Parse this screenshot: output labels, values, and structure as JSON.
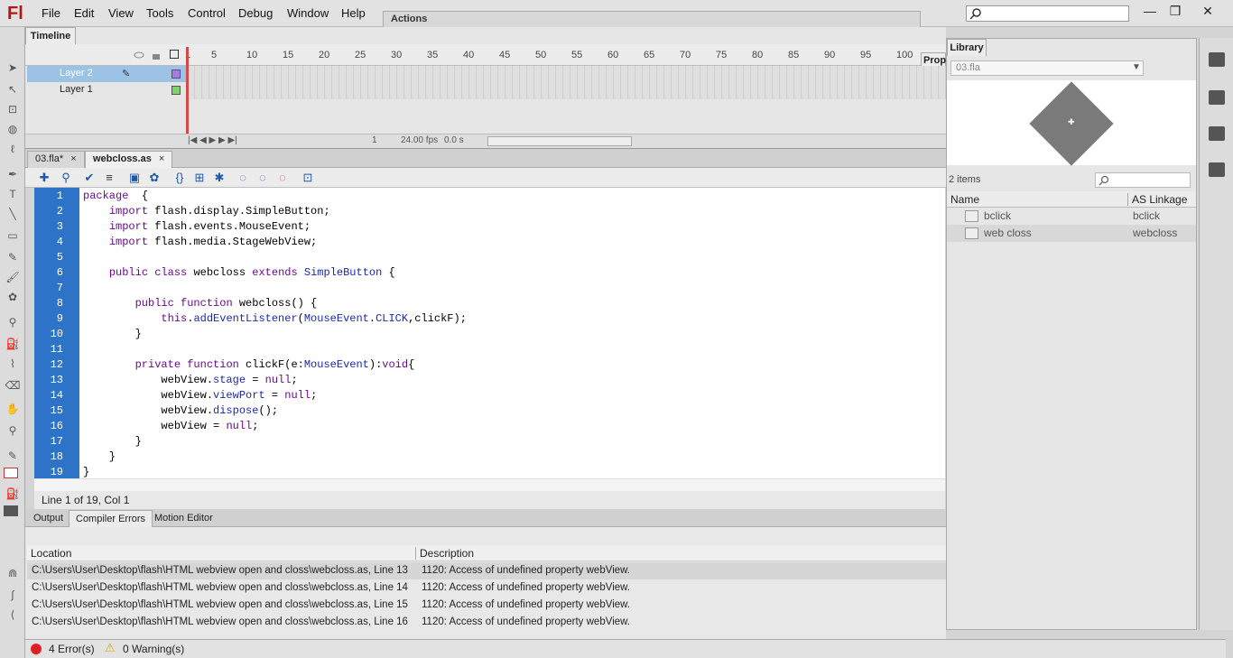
{
  "app": {
    "logo": "Fl"
  },
  "menu": [
    "File",
    "Edit",
    "View",
    "Tools",
    "Control",
    "Debug",
    "Window",
    "Help"
  ],
  "actions_panel": {
    "title": "Actions"
  },
  "window_controls": {
    "minimize": "—",
    "restore": "❐",
    "close": "✕"
  },
  "timeline": {
    "tab": "Timeline",
    "ticks": [
      "1",
      "5",
      "10",
      "15",
      "20",
      "25",
      "30",
      "35",
      "40",
      "45",
      "50",
      "55",
      "60",
      "65",
      "70",
      "75",
      "80",
      "85",
      "90",
      "95",
      "100"
    ],
    "layers": [
      {
        "name": "Layer 2",
        "selected": true,
        "color": "#a77be6"
      },
      {
        "name": "Layer 1",
        "selected": false,
        "color": "#80d26b"
      }
    ],
    "frame": "1",
    "fps": "24.00 fps",
    "time": "0.0 s",
    "properties_tab": "Prop"
  },
  "doc_tabs": [
    {
      "label": "03.fla*",
      "close": "×",
      "active": false
    },
    {
      "label": "webcloss.as",
      "close": "×",
      "active": true
    }
  ],
  "editor": {
    "lines": [
      {
        "num": "1",
        "html": "<span class=\"kw\">package</span>  {"
      },
      {
        "num": "2",
        "html": "    <span class=\"kw\">import</span> flash.display.SimpleButton;"
      },
      {
        "num": "3",
        "html": "    <span class=\"kw\">import</span> flash.events.MouseEvent;"
      },
      {
        "num": "4",
        "html": "    <span class=\"kw\">import</span> flash.media.StageWebView;"
      },
      {
        "num": "5",
        "html": ""
      },
      {
        "num": "6",
        "html": "    <span class=\"kw\">public</span> <span class=\"kw\">class</span> webcloss <span class=\"kw\">extends</span> <span class=\"cls\">SimpleButton</span> {"
      },
      {
        "num": "7",
        "html": ""
      },
      {
        "num": "8",
        "html": "        <span class=\"kw\">public</span> <span class=\"kw\">function</span> webcloss() {"
      },
      {
        "num": "9",
        "html": "            <span class=\"kw\">this</span>.<span class=\"pr\">addEventListener</span>(<span class=\"cls\">MouseEvent</span>.<span class=\"pr\">CLICK</span>,clickF);"
      },
      {
        "num": "10",
        "html": "        }"
      },
      {
        "num": "11",
        "html": ""
      },
      {
        "num": "12",
        "html": "        <span class=\"kw\">private</span> <span class=\"kw\">function</span> clickF(e:<span class=\"cls\">MouseEvent</span>):<span class=\"kw\">void</span>{"
      },
      {
        "num": "13",
        "html": "            webView.<span class=\"pr\">stage</span> = <span class=\"kw\">null</span>;"
      },
      {
        "num": "14",
        "html": "            webView.<span class=\"pr\">viewPort</span> = <span class=\"kw\">null</span>;"
      },
      {
        "num": "15",
        "html": "            webView.<span class=\"pr\">dispose</span>();"
      },
      {
        "num": "16",
        "html": "            webView = <span class=\"kw\">null</span>;"
      },
      {
        "num": "17",
        "html": "        }"
      },
      {
        "num": "18",
        "html": "    }"
      },
      {
        "num": "19",
        "html": "}"
      }
    ],
    "status": "Line 1 of 19, Col 1"
  },
  "bottom_tabs": [
    {
      "label": "Output",
      "active": false
    },
    {
      "label": "Compiler Errors",
      "active": true
    },
    {
      "label": "Motion Editor",
      "active": false
    }
  ],
  "errors": {
    "headers": {
      "location": "Location",
      "description": "Description"
    },
    "rows": [
      {
        "location": "C:\\Users\\User\\Desktop\\flash\\HTML webview open and closs\\webcloss.as, Line 13",
        "description": "1120: Access of undefined property webView."
      },
      {
        "location": "C:\\Users\\User\\Desktop\\flash\\HTML webview open and closs\\webcloss.as, Line 14",
        "description": "1120: Access of undefined property webView."
      },
      {
        "location": "C:\\Users\\User\\Desktop\\flash\\HTML webview open and closs\\webcloss.as, Line 15",
        "description": "1120: Access of undefined property webView."
      },
      {
        "location": "C:\\Users\\User\\Desktop\\flash\\HTML webview open and closs\\webcloss.as, Line 16",
        "description": "1120: Access of undefined property webView."
      }
    ],
    "error_count": "4 Error(s)",
    "warning_count": "0 Warning(s)"
  },
  "library": {
    "tab": "Library",
    "document": "03.fla",
    "count": "2 items",
    "headers": {
      "name": "Name",
      "linkage": "AS Linkage"
    },
    "items": [
      {
        "name": "bclick",
        "linkage": "bclick"
      },
      {
        "name": "web closs",
        "linkage": "webcloss"
      }
    ]
  },
  "colors": {
    "gutter": "#2d74c8",
    "keyword": "#6a0a8f",
    "class": "#1a2aa8",
    "error": "#e02020"
  }
}
